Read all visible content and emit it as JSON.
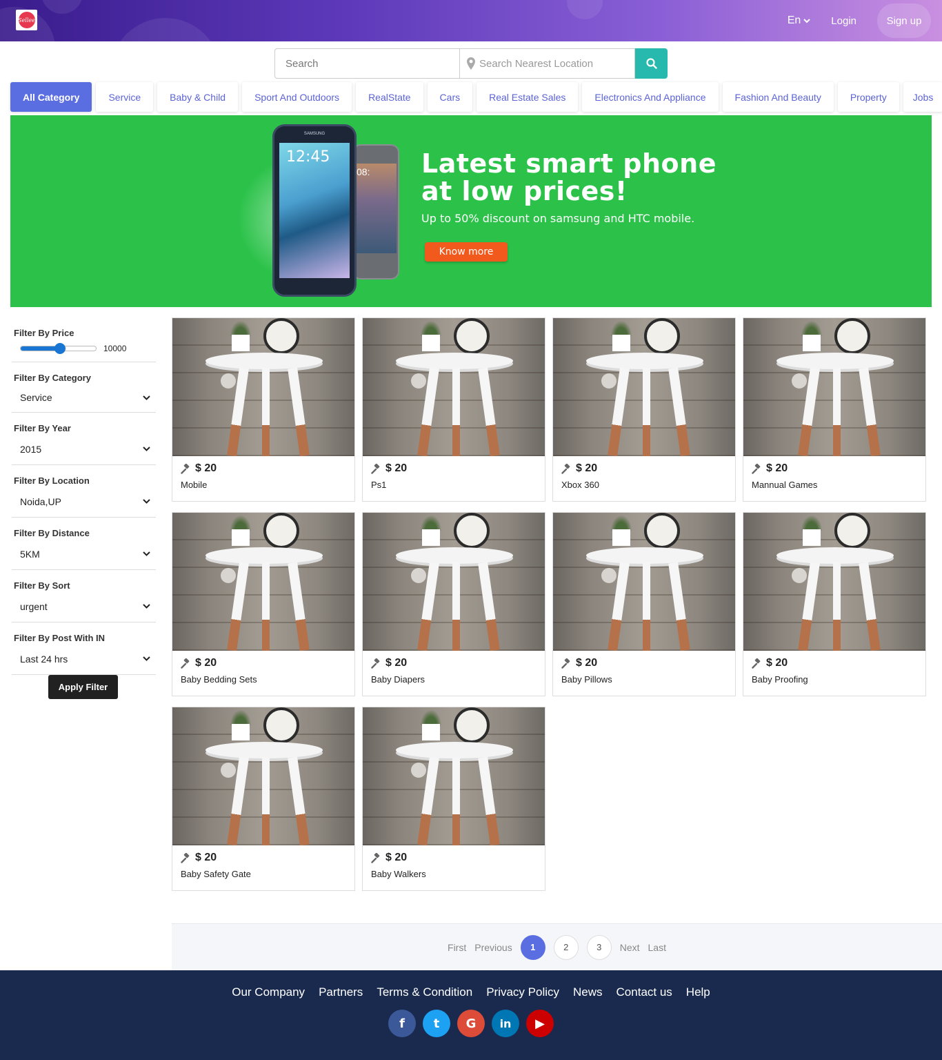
{
  "header": {
    "logo_text": "Sellee",
    "language": "En",
    "login": "Login",
    "signup": "Sign up"
  },
  "search": {
    "placeholder": "Search",
    "location_placeholder": "Search Nearest Location"
  },
  "categories": [
    "All Category",
    "Service",
    "Baby & Child",
    "Sport And Outdoors",
    "RealState",
    "Cars",
    "Real Estate Sales",
    "Electronics And Appliance",
    "Fashion And Beauty",
    "Property",
    "Jobs"
  ],
  "banner": {
    "title_line1": "Latest smart phone",
    "title_line2": "at low prices!",
    "subtitle": "Up to 50% discount on samsung and HTC mobile.",
    "button": "Know more",
    "phone1_brand": "SAMSUNG",
    "phone1_time": "12:45",
    "phone2_time": "08:",
    "background_color": "#2cc24a"
  },
  "filters": {
    "price": {
      "label": "Filter By Price",
      "value": "10000",
      "level": 0.52
    },
    "category": {
      "label": "Filter By Category",
      "selected": "Service"
    },
    "year": {
      "label": "Filter By Year",
      "selected": "2015"
    },
    "location": {
      "label": "Filter By Location",
      "selected": "Noida,UP"
    },
    "distance": {
      "label": "Filter By Distance",
      "selected": "5KM"
    },
    "sort": {
      "label": "Filter By Sort",
      "selected": "urgent"
    },
    "posted": {
      "label": "Filter By Post With IN",
      "selected": "Last 24 hrs"
    },
    "apply": "Apply Filter"
  },
  "products": [
    {
      "price": "$ 20",
      "name": "Mobile"
    },
    {
      "price": "$ 20",
      "name": "Ps1"
    },
    {
      "price": "$ 20",
      "name": "Xbox 360"
    },
    {
      "price": "$ 20",
      "name": "Mannual Games"
    },
    {
      "price": "$ 20",
      "name": "Baby Bedding Sets"
    },
    {
      "price": "$ 20",
      "name": "Baby Diapers"
    },
    {
      "price": "$ 20",
      "name": "Baby Pillows"
    },
    {
      "price": "$ 20",
      "name": "Baby Proofing"
    },
    {
      "price": "$ 20",
      "name": "Baby Safety Gate"
    },
    {
      "price": "$ 20",
      "name": "Baby Walkers"
    }
  ],
  "pagination": {
    "first": "First",
    "previous": "Previous",
    "pages": [
      "1",
      "2",
      "3"
    ],
    "current": "1",
    "next": "Next",
    "last": "Last"
  },
  "footer": {
    "links": [
      "Our Company",
      "Partners",
      "Terms & Condition",
      "Privacy Policy",
      "News",
      "Contact us",
      "Help"
    ],
    "socials": [
      {
        "icon": "facebook-icon",
        "glyph": "f",
        "color": "#3b5998"
      },
      {
        "icon": "twitter-icon",
        "glyph": "t",
        "color": "#1da1f2"
      },
      {
        "icon": "google-icon",
        "glyph": "G",
        "color": "#dd4b39"
      },
      {
        "icon": "linkedin-icon",
        "glyph": "in",
        "color": "#0077b5"
      },
      {
        "icon": "youtube-icon",
        "glyph": "▶",
        "color": "#cc0000"
      }
    ]
  }
}
